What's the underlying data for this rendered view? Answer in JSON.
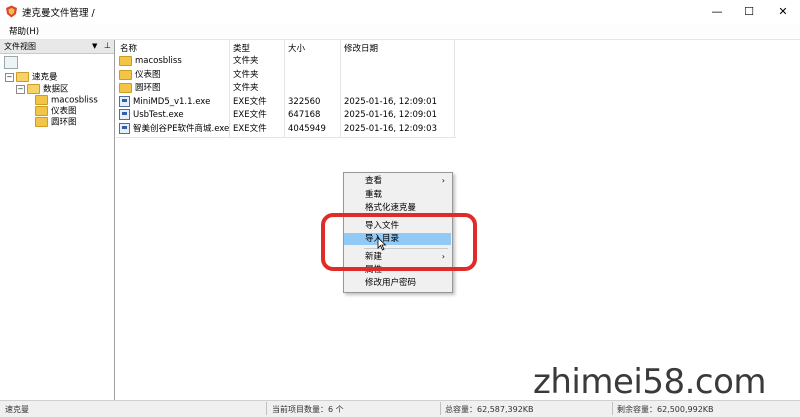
{
  "window": {
    "title": "速克曼文件管理 /"
  },
  "titlebar_buttons": [
    {
      "name": "minimize-button",
      "glyph": "—"
    },
    {
      "name": "maximize-button",
      "glyph": "☐"
    },
    {
      "name": "close-button",
      "glyph": "✕"
    }
  ],
  "menu": {
    "help": "帮助(H)"
  },
  "left_pane": {
    "title": "文件视图",
    "pin_arrow": "▼",
    "pin_icon": "⊥",
    "tree": [
      {
        "label": "速克曼",
        "expander": "−"
      },
      {
        "label": "数据区",
        "expander": "−"
      },
      {
        "label": "macosbliss"
      },
      {
        "label": "仪表图"
      },
      {
        "label": "圆环图"
      }
    ]
  },
  "list": {
    "columns": [
      "名称",
      "类型",
      "大小",
      "修改日期"
    ],
    "rows": [
      {
        "name": "macosbliss",
        "type": "文件夹",
        "size": "",
        "date": "",
        "icon": "folder-icon"
      },
      {
        "name": "仪表图",
        "type": "文件夹",
        "size": "",
        "date": "",
        "icon": "folder-icon"
      },
      {
        "name": "圆环图",
        "type": "文件夹",
        "size": "",
        "date": "",
        "icon": "folder-icon"
      },
      {
        "name": "MiniMD5_v1.1.exe",
        "type": "EXE文件",
        "size": "322560",
        "date": "2025-01-16, 12:09:01",
        "icon": "exe-icon"
      },
      {
        "name": "UsbTest.exe",
        "type": "EXE文件",
        "size": "647168",
        "date": "2025-01-16, 12:09:01",
        "icon": "exe-icon"
      },
      {
        "name": "智美创谷PE软件商城.exe",
        "type": "EXE文件",
        "size": "4045949",
        "date": "2025-01-16, 12:09:03",
        "icon": "exe-icon"
      }
    ]
  },
  "context_menu": {
    "items": [
      {
        "label": "查看",
        "submenu": "›"
      },
      {
        "label": "重载"
      },
      {
        "label": "格式化速克曼"
      },
      {
        "label": "导入文件"
      },
      {
        "label": "导入目录",
        "highlighted": true
      },
      {
        "label": "新建",
        "submenu": "›"
      },
      {
        "label": "属性"
      },
      {
        "label": "修改用户密码"
      }
    ]
  },
  "status": {
    "left": "速克曼",
    "count": "当前项目数量：6 个",
    "total": "总容量：62,587,392KB",
    "free": "剩余容量：62,500,992KB"
  },
  "watermark": "zhimei58.com",
  "colors": {
    "highlight": "#91c9f7",
    "annotation_ring": "#e02b2b",
    "folder": "#f2c549"
  }
}
